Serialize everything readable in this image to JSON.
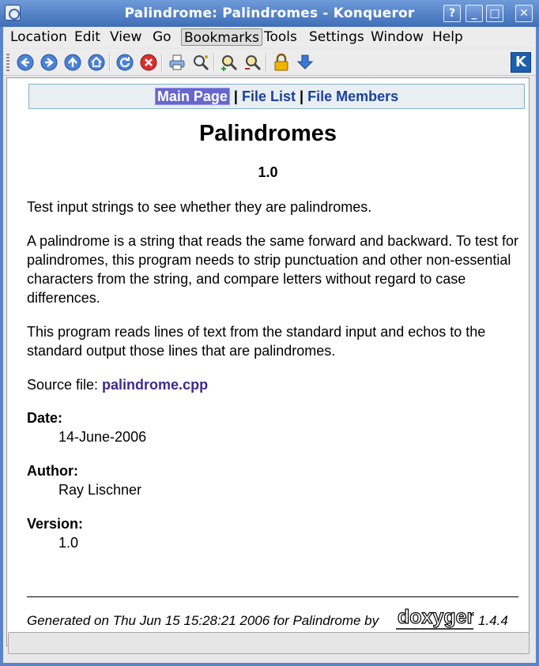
{
  "window": {
    "title": "Palindrome: Palindromes - Konqueror",
    "buttons": {
      "help": "?",
      "minimize": "_",
      "maximize": "□",
      "close": "✕"
    }
  },
  "menubar": {
    "items": [
      "Location",
      "Edit",
      "View",
      "Go",
      "Bookmarks",
      "Tools",
      "Settings",
      "Window",
      "Help"
    ],
    "active": "Bookmarks"
  },
  "toolbar": {
    "icons": [
      "back-icon",
      "forward-icon",
      "up-icon",
      "home-icon",
      "reload-icon",
      "stop-icon",
      "print-icon",
      "find-icon",
      "zoom-in-icon",
      "zoom-out-icon",
      "security-lock-icon",
      "download-icon",
      "kde-logo-icon"
    ],
    "colors": {
      "accent": "#3a6fc4",
      "stop": "#d83030",
      "lock": "#e8a800"
    }
  },
  "nav": {
    "main_page": "Main Page",
    "sep1": "|",
    "file_list": "File List",
    "sep2": "|",
    "file_members": "File Members"
  },
  "doc": {
    "title": "Palindromes",
    "version_heading": "1.0",
    "paragraph1": "Test input strings to see whether they are palindromes.",
    "paragraph2": "A palindrome is a string that reads the same forward and backward. To test for palindromes, this program needs to strip punctuation and other non-essential characters from the string, and compare letters without regard to case differences.",
    "paragraph3": "This program reads lines of text from the standard input and echos to the standard output those lines that are palindromes.",
    "source_label": "Source file: ",
    "source_link": "palindrome.cpp",
    "date_label": "Date:",
    "date_value": "14-June-2006",
    "author_label": "Author:",
    "author_value": "Ray Lischner",
    "version_label": "Version:",
    "version_value": "1.0"
  },
  "footer": {
    "generated": "Generated on Thu Jun 15 15:28:21 2006 for Palindrome by",
    "logo_text": "doxygen",
    "doxygen_version": "1.4.4"
  },
  "colors": {
    "link": "#1a419d",
    "visited_link": "#3d2a8e",
    "current_tab_bg": "#6666cc",
    "nav_bg": "#e8eef2"
  }
}
